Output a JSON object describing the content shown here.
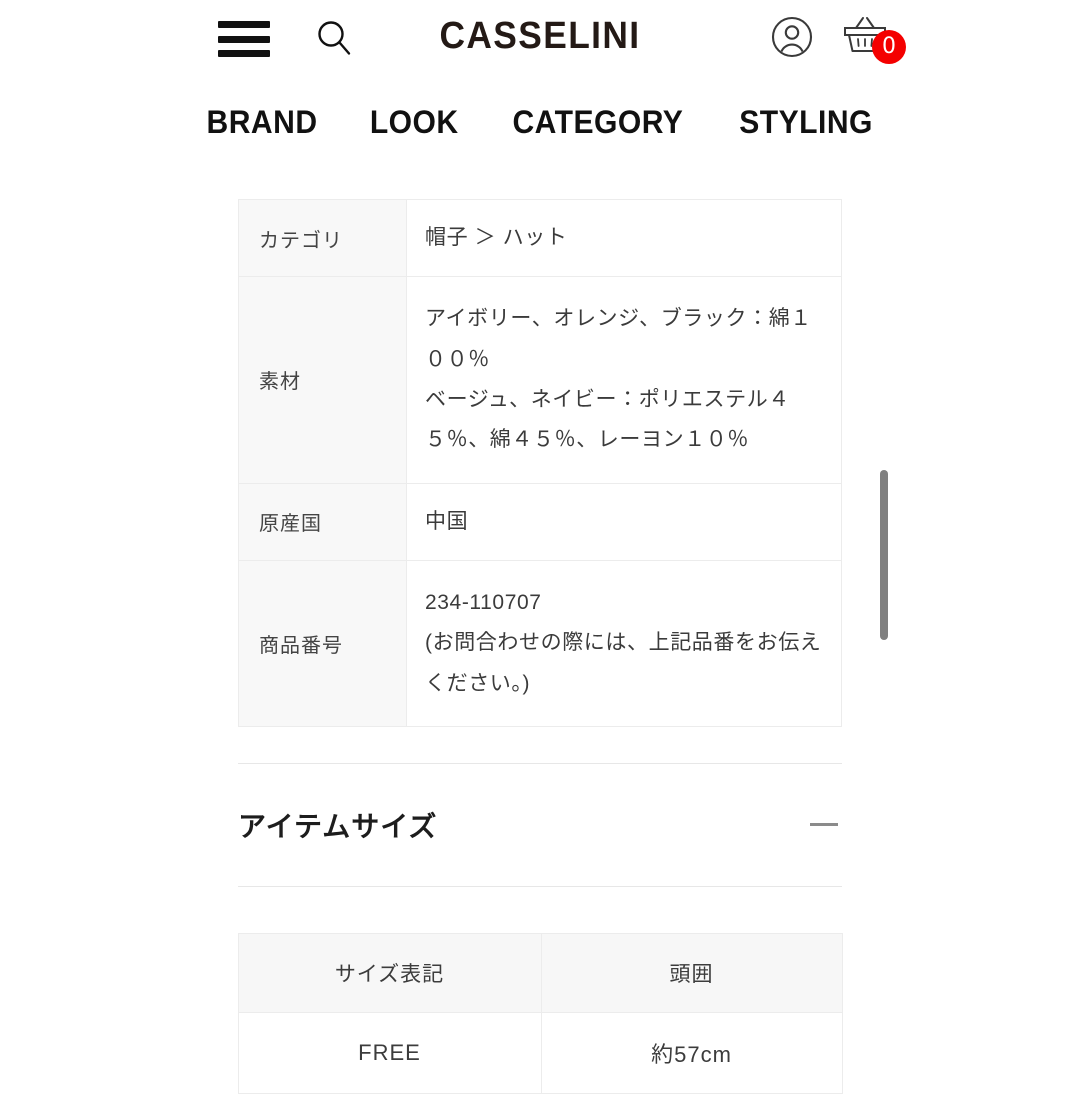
{
  "header": {
    "logo": "CASSELINI",
    "menu_icon": "hamburger-icon",
    "search_icon": "search-icon",
    "account_icon": "account-icon",
    "cart_icon": "cart-basket-icon",
    "cart_count": "0",
    "cart_badge_color": "#f40000"
  },
  "globalnav": {
    "items": [
      {
        "label": "BRAND"
      },
      {
        "label": "LOOK"
      },
      {
        "label": "CATEGORY"
      },
      {
        "label": "STYLING"
      }
    ]
  },
  "spec_table": {
    "rows": [
      {
        "label": "カテゴリ",
        "value": "帽子 ＞ ハット"
      },
      {
        "label": "素材",
        "value": "アイボリー、オレンジ、ブラック：綿１００％\nベージュ、ネイビー：ポリエステル４５％、綿４５％、レーヨン１０％"
      },
      {
        "label": "原産国",
        "value": "中国"
      },
      {
        "label": "商品番号",
        "value": "234-110707\n(お問合わせの際には、上記品番をお伝えください。)"
      }
    ]
  },
  "accordion": {
    "title": "アイテムサイズ",
    "toggle_icon": "minus-icon",
    "expanded": true
  },
  "size_table": {
    "headers": [
      "サイズ表記",
      "頭囲"
    ],
    "rows": [
      [
        "FREE",
        "約57cm"
      ]
    ]
  },
  "scrollbar": {
    "name": "page-scrollbar",
    "color": "#808080"
  }
}
